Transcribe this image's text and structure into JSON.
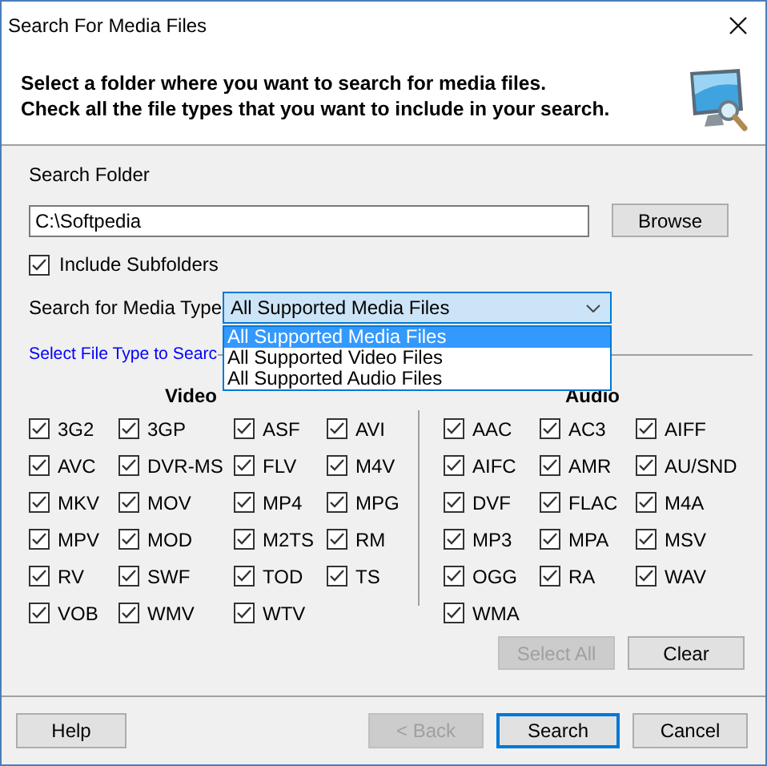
{
  "window": {
    "title": "Search For Media Files"
  },
  "header": {
    "lines": [
      "Select a folder where you want to search for media files.",
      "Check all the file types that you want to include in your search."
    ]
  },
  "search_folder": {
    "label": "Search Folder",
    "value": "C:\\Softpedia",
    "button": "Browse"
  },
  "include_subfolders": {
    "label": "Include Subfolders",
    "checked": true
  },
  "media_type": {
    "label": "Search for Media Type",
    "value": "All Supported Media Files",
    "expanded": true,
    "options": [
      {
        "label": "All Supported Media Files",
        "selected": true
      },
      {
        "label": "All Supported Video Files",
        "selected": false
      },
      {
        "label": "All Supported Audio Files",
        "selected": false
      }
    ]
  },
  "file_types": {
    "title": "Select File Type to Searc",
    "video": {
      "heading": "Video",
      "items": [
        {
          "label": "3G2",
          "checked": true
        },
        {
          "label": "3GP",
          "checked": true
        },
        {
          "label": "ASF",
          "checked": true
        },
        {
          "label": "AVI",
          "checked": true
        },
        {
          "label": "AVC",
          "checked": true
        },
        {
          "label": "DVR-MS",
          "checked": true
        },
        {
          "label": "FLV",
          "checked": true
        },
        {
          "label": "M4V",
          "checked": true
        },
        {
          "label": "MKV",
          "checked": true
        },
        {
          "label": "MOV",
          "checked": true
        },
        {
          "label": "MP4",
          "checked": true
        },
        {
          "label": "MPG",
          "checked": true
        },
        {
          "label": "MPV",
          "checked": true
        },
        {
          "label": "MOD",
          "checked": true
        },
        {
          "label": "M2TS",
          "checked": true
        },
        {
          "label": "RM",
          "checked": true
        },
        {
          "label": "RV",
          "checked": true
        },
        {
          "label": "SWF",
          "checked": true
        },
        {
          "label": "TOD",
          "checked": true
        },
        {
          "label": "TS",
          "checked": true
        },
        {
          "label": "VOB",
          "checked": true
        },
        {
          "label": "WMV",
          "checked": true
        },
        {
          "label": "WTV",
          "checked": true
        }
      ]
    },
    "audio": {
      "heading": "Audio",
      "items": [
        {
          "label": "AAC",
          "checked": true
        },
        {
          "label": "AC3",
          "checked": true
        },
        {
          "label": "AIFF",
          "checked": true
        },
        {
          "label": "AIFC",
          "checked": true
        },
        {
          "label": "AMR",
          "checked": true
        },
        {
          "label": "AU/SND",
          "checked": true
        },
        {
          "label": "DVF",
          "checked": true
        },
        {
          "label": "FLAC",
          "checked": true
        },
        {
          "label": "M4A",
          "checked": true
        },
        {
          "label": "MP3",
          "checked": true
        },
        {
          "label": "MPA",
          "checked": true
        },
        {
          "label": "MSV",
          "checked": true
        },
        {
          "label": "OGG",
          "checked": true
        },
        {
          "label": "RA",
          "checked": true
        },
        {
          "label": "WAV",
          "checked": true
        },
        {
          "label": "WMA",
          "checked": true
        }
      ]
    },
    "buttons": [
      {
        "label": "Select All",
        "disabled": true
      },
      {
        "label": "Clear",
        "disabled": false
      }
    ]
  },
  "footer": {
    "help": {
      "label": "Help",
      "disabled": false
    },
    "buttons": [
      {
        "label": "< Back",
        "disabled": true,
        "default": false
      },
      {
        "label": "Search",
        "disabled": false,
        "default": true
      },
      {
        "label": "Cancel",
        "disabled": false,
        "default": false
      }
    ]
  }
}
